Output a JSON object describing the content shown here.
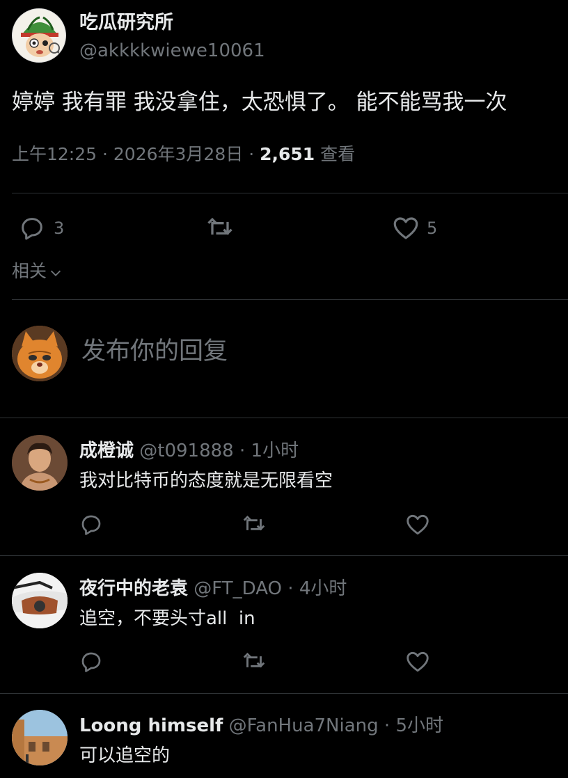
{
  "post": {
    "author_name": "吃瓜研究所",
    "author_handle": "@akkkkwiewe10061",
    "text": "婷婷 我有罪 我没拿住，太恐惧了。 能不能骂我一次",
    "time": "上午12:25",
    "date": "2026年3月28日",
    "views_count": "2,651",
    "views_label": "查看",
    "reply_count": "3",
    "like_count": "5",
    "relevance_label": "相关"
  },
  "composer": {
    "placeholder": "发布你的回复"
  },
  "replies": [
    {
      "name": "成橙诚",
      "handle": "@t091888",
      "time": "1小时",
      "text": "我对比特币的态度就是无限看空"
    },
    {
      "name": "夜行中的老袁",
      "handle": "@FT_DAO",
      "time": "4小时",
      "text": "追空，不要头寸all  in"
    },
    {
      "name": "Loong himself",
      "handle": "@FanHua7Niang",
      "time": "5小时",
      "text": "可以追空的"
    }
  ],
  "colors": {
    "background": "#000000",
    "text_primary": "#e7e9ea",
    "text_muted": "#71767b",
    "divider": "#2f3336"
  }
}
